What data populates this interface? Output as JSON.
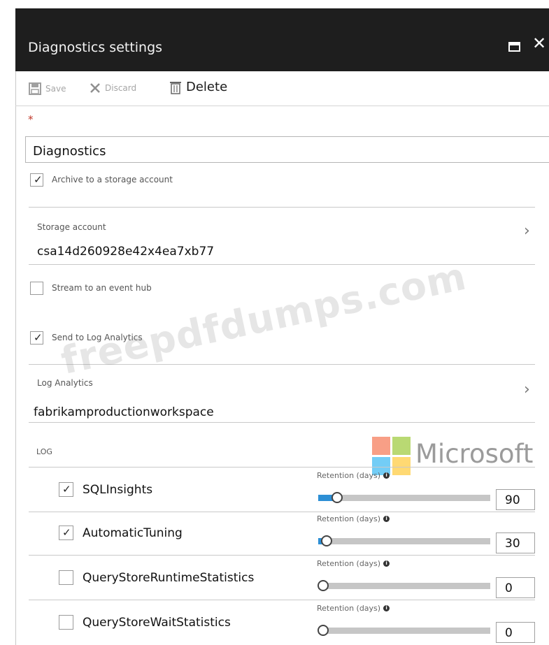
{
  "window": {
    "title": "Diagnostics settings",
    "maximize_icon": "maximize-icon",
    "close_glyph": "✕"
  },
  "toolbar": {
    "save_label": "Save",
    "discard_label": "Discard",
    "delete_label": "Delete"
  },
  "form": {
    "required_mark": "*",
    "name_value": "Diagnostics",
    "archive": {
      "label": "Archive to a storage account",
      "checked": true
    },
    "storage": {
      "caption": "Storage account",
      "value": "csa14d260928e42x4ea7xb77"
    },
    "event_hub": {
      "label": "Stream to an event hub",
      "checked": false
    },
    "log_analytics_toggle": {
      "label": "Send to Log Analytics",
      "checked": true
    },
    "log_analytics": {
      "caption": "Log Analytics",
      "value": "fabrikamproductionworkspace"
    }
  },
  "log": {
    "section_label": "LOG",
    "retention_label": "Retention (days)",
    "rows": [
      {
        "name": "SQLInsights",
        "checked": true,
        "retention": "90",
        "fill": 0.11
      },
      {
        "name": "AutomaticTuning",
        "checked": true,
        "retention": "30",
        "fill": 0.05
      },
      {
        "name": "QueryStoreRuntimeStatistics",
        "checked": false,
        "retention": "0",
        "fill": 0
      },
      {
        "name": "QueryStoreWaitStatistics",
        "checked": false,
        "retention": "0",
        "fill": 0
      }
    ]
  },
  "overlays": {
    "watermark": "freepdfdumps.com",
    "brand": "Microsoft",
    "brand_colors": [
      "#f25022",
      "#7fba00",
      "#00a4ef",
      "#ffb900"
    ]
  }
}
